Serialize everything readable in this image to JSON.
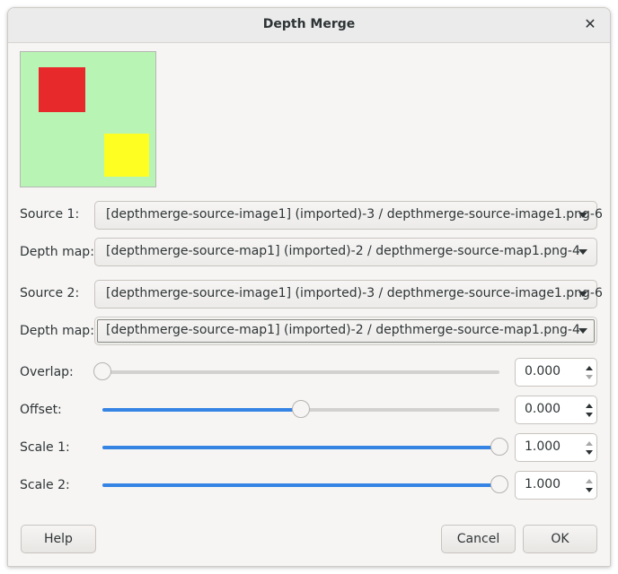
{
  "window": {
    "title": "Depth Merge",
    "close_glyph": "✕"
  },
  "colors": {
    "preview_bg": "#b8f4b4",
    "red_square": "#e8292c",
    "yellow_square": "#fefe22",
    "accent": "#3584e4"
  },
  "source1": {
    "label": "Source 1:",
    "value": "[depthmerge-source-image1] (imported)-3 / depthmerge-source-image1.png-6"
  },
  "depthmap1": {
    "label": "Depth map:",
    "value": "[depthmerge-source-map1] (imported)-2 / depthmerge-source-map1.png-4"
  },
  "source2": {
    "label": "Source 2:",
    "value": "[depthmerge-source-image1] (imported)-3 / depthmerge-source-image1.png-6"
  },
  "depthmap2": {
    "label": "Depth map:",
    "value": "[depthmerge-source-map1] (imported)-2 / depthmerge-source-map1.png-4"
  },
  "overlap": {
    "label": "Overlap:",
    "value": "0.000",
    "fraction": 0.0
  },
  "offset": {
    "label": "Offset:",
    "value": "0.000",
    "fraction": 0.5
  },
  "scale1": {
    "label": "Scale 1:",
    "value": "1.000",
    "fraction": 1.0
  },
  "scale2": {
    "label": "Scale 2:",
    "value": "1.000",
    "fraction": 1.0
  },
  "buttons": {
    "help": "Help",
    "cancel": "Cancel",
    "ok": "OK"
  }
}
